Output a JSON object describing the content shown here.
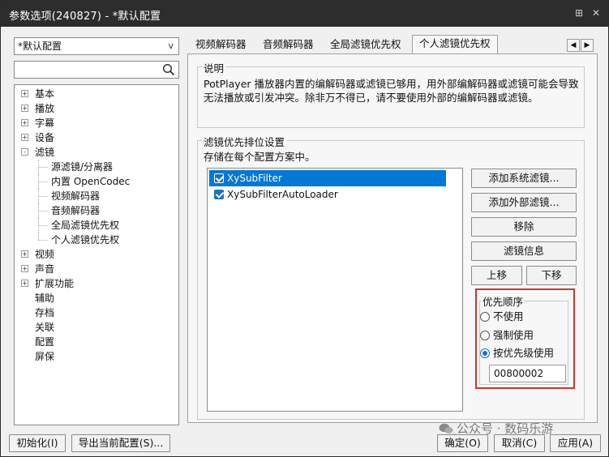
{
  "window": {
    "title": "参数选项(240827) - *默认配置",
    "pin_glyph": "⊞",
    "close_glyph": "✕"
  },
  "sidebar": {
    "preset_value": "*默认配置",
    "preset_chevron": "v",
    "search_placeholder": "",
    "tree": [
      {
        "label": "基本",
        "expander": "+",
        "child": false
      },
      {
        "label": "播放",
        "expander": "+",
        "child": false
      },
      {
        "label": "字幕",
        "expander": "+",
        "child": false
      },
      {
        "label": "设备",
        "expander": "+",
        "child": false
      },
      {
        "label": "滤镜",
        "expander": "-",
        "child": false
      },
      {
        "label": "源滤镜/分离器",
        "expander": "",
        "child": true
      },
      {
        "label": "内置 OpenCodec",
        "expander": "",
        "child": true
      },
      {
        "label": "视频解码器",
        "expander": "",
        "child": true
      },
      {
        "label": "音频解码器",
        "expander": "",
        "child": true
      },
      {
        "label": "全局滤镜优先权",
        "expander": "",
        "child": true
      },
      {
        "label": "个人滤镜优先权",
        "expander": "",
        "child": true
      },
      {
        "label": "视频",
        "expander": "+",
        "child": false
      },
      {
        "label": "声音",
        "expander": "+",
        "child": false
      },
      {
        "label": "扩展功能",
        "expander": "+",
        "child": false
      },
      {
        "label": "辅助",
        "expander": "",
        "child": false
      },
      {
        "label": "存档",
        "expander": "",
        "child": false
      },
      {
        "label": "关联",
        "expander": "",
        "child": false
      },
      {
        "label": "配置",
        "expander": "",
        "child": false
      },
      {
        "label": "屏保",
        "expander": "",
        "child": false
      }
    ]
  },
  "tabs": [
    {
      "label": "视频解码器"
    },
    {
      "label": "音频解码器"
    },
    {
      "label": "全局滤镜优先权"
    },
    {
      "label": "个人滤镜优先权"
    }
  ],
  "tab_arrows": {
    "left": "◀",
    "right": "▶"
  },
  "description": {
    "legend": "说明",
    "text": "PotPlayer 播放器内置的编解码器或滤镜已够用，用外部编解码器或滤镜可能会导致无法播放或引发冲突。除非万不得已，请不要使用外部的编解码器或滤镜。"
  },
  "priority_settings": {
    "legend": "滤镜优先排位设置",
    "note": "存储在每个配置方案中。",
    "filters": [
      {
        "name": "XySubFilter",
        "checked": true,
        "selected": true
      },
      {
        "name": "XySubFilterAutoLoader",
        "checked": true,
        "selected": false
      }
    ],
    "buttons": {
      "add_system": "添加系统滤镜...",
      "add_external": "添加外部滤镜...",
      "remove": "移除",
      "info": "滤镜信息",
      "move_up": "上移",
      "move_down": "下移"
    }
  },
  "priority_order": {
    "legend": "优先顺序",
    "options": [
      {
        "label": "不使用",
        "selected": false
      },
      {
        "label": "强制使用",
        "selected": false
      },
      {
        "label": "按优先级使用",
        "selected": true
      }
    ],
    "value": "00800002"
  },
  "footer": {
    "reset": "初始化(I)",
    "export": "导出当前配置(S)...",
    "ok": "确定(O)",
    "cancel": "取消(C)",
    "apply": "应用(A)"
  },
  "watermark": "公众号 · 数码乐游",
  "colors": {
    "titlebar": "#2d2d2d",
    "selection": "#0078d7",
    "highlight_box": "#d0342c",
    "checkbox": "#1a6fc9"
  }
}
